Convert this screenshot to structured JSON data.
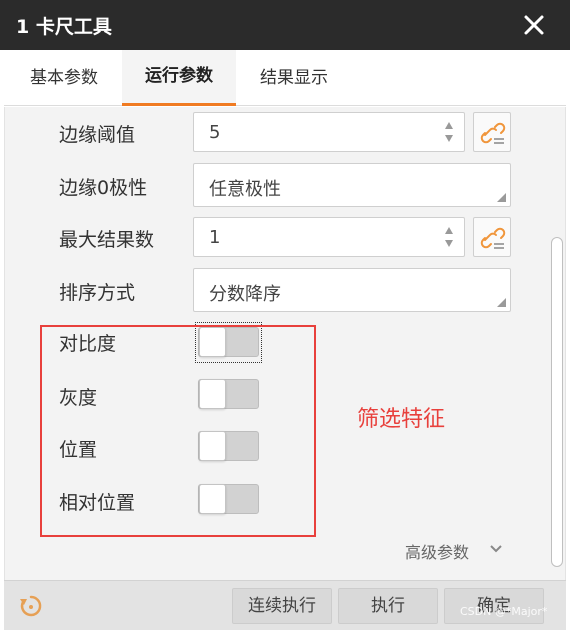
{
  "window": {
    "title": "1 卡尺工具"
  },
  "tabs": [
    {
      "label": "基本参数"
    },
    {
      "label": "运行参数",
      "active": true
    },
    {
      "label": "结果显示"
    }
  ],
  "params": {
    "edge_threshold": {
      "label": "边缘阈值",
      "value": "5"
    },
    "edge0_polarity": {
      "label": "边缘0极性",
      "value": "任意极性"
    },
    "max_results": {
      "label": "最大结果数",
      "value": "1"
    },
    "sort_mode": {
      "label": "排序方式",
      "value": "分数降序"
    }
  },
  "features": {
    "contrast": {
      "label": "对比度",
      "enabled": false
    },
    "gray": {
      "label": "灰度",
      "enabled": false
    },
    "position": {
      "label": "位置",
      "enabled": false
    },
    "relative_position": {
      "label": "相对位置",
      "enabled": false
    }
  },
  "annotation": {
    "text": "筛选特征",
    "color": "#e8403c"
  },
  "advanced": {
    "label": "高级参数"
  },
  "footer": {
    "continuous_label": "连续执行",
    "execute_label": "执行",
    "ok_label": "确定"
  },
  "watermark": "CSDN @*Major*",
  "colors": {
    "accent": "#f07b22",
    "titlebar": "#2b2b2b",
    "link_icon": "#f0963c"
  }
}
